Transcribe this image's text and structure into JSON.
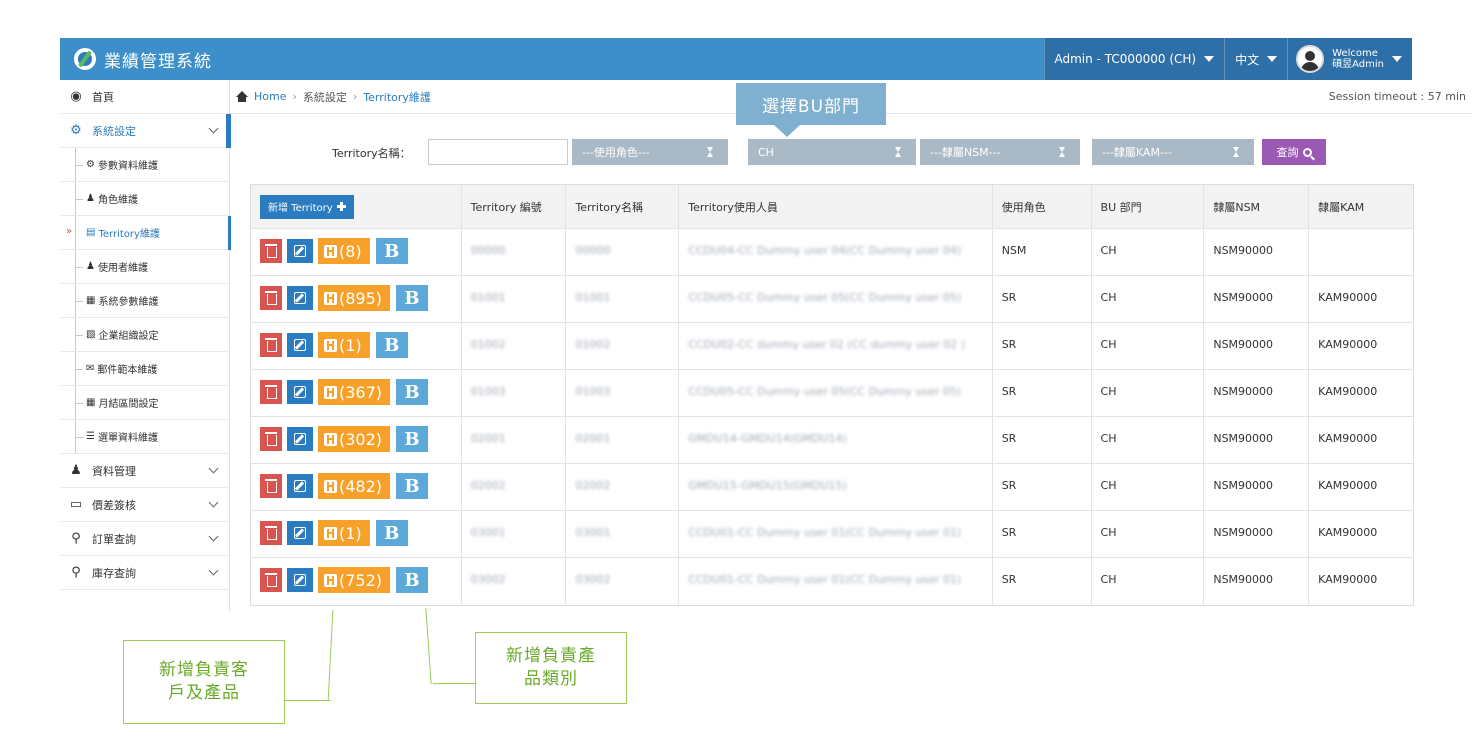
{
  "topbar": {
    "brand": "業績管理系統",
    "org_dropdown": "Admin - TC000000 (CH)",
    "language": "中文",
    "welcome_line1": "Welcome",
    "welcome_line2": "碩昱Admin"
  },
  "sidebar": {
    "items": [
      {
        "label": "首頁",
        "icon": "dashboard-icon"
      },
      {
        "label": "系統設定",
        "icon": "cogs-icon"
      }
    ],
    "sub_items": [
      {
        "label": "參數資料維護",
        "icon": "gear-icon"
      },
      {
        "label": "角色維護",
        "icon": "person-icon"
      },
      {
        "label": "Territory維護",
        "icon": "building-icon"
      },
      {
        "label": "使用者維護",
        "icon": "user-icon"
      },
      {
        "label": "系統參數維護",
        "icon": "table-icon"
      },
      {
        "label": "企業組織設定",
        "icon": "sitemap-icon"
      },
      {
        "label": "郵件範本維護",
        "icon": "envelope-icon"
      },
      {
        "label": "月結區間設定",
        "icon": "table-icon"
      },
      {
        "label": "選單資料維護",
        "icon": "list-icon"
      }
    ],
    "lower_items": [
      {
        "label": "資料管理",
        "icon": "users-icon"
      },
      {
        "label": "價差簽核",
        "icon": "monitor-icon"
      },
      {
        "label": "訂單查詢",
        "icon": "search-icon"
      },
      {
        "label": "庫存查詢",
        "icon": "search-icon"
      }
    ]
  },
  "breadcrumb": {
    "home": "Home",
    "sep": "›",
    "level1": "系統設定",
    "level2": "Territory維護",
    "session": "Session timeout : 57 min"
  },
  "callout_top": "選擇BU部門",
  "filters": {
    "name_label": "Territory名稱：",
    "name_value": "",
    "role_select": "---使用角色---",
    "bu_select": "CH",
    "nsm_select": "---隸屬NSM---",
    "kam_select": "---隸屬KAM---",
    "search_label": "查詢"
  },
  "table": {
    "add_button": "新增 Territory",
    "headers": [
      "Territory 編號",
      "Territory名稱",
      "Territory使用人員",
      "使用角色",
      "BU 部門",
      "隸屬NSM",
      "隸屬KAM"
    ],
    "b_label": "B",
    "rows": [
      {
        "count": "(8)",
        "code": "00000",
        "name": "00000",
        "user": "CCDU04-CC Dummy user 04(CC Dummy user 04)",
        "role": "NSM",
        "bu": "CH",
        "nsm": "NSM90000",
        "kam": ""
      },
      {
        "count": "(895)",
        "code": "01001",
        "name": "01001",
        "user": "CCDU05-CC Dummy user 05(CC Dummy user 05)",
        "role": "SR",
        "bu": "CH",
        "nsm": "NSM90000",
        "kam": "KAM90000"
      },
      {
        "count": "(1)",
        "code": "01002",
        "name": "01002",
        "user": "CCDU02-CC dummy user 02 (CC dummy user 02 )",
        "role": "SR",
        "bu": "CH",
        "nsm": "NSM90000",
        "kam": "KAM90000"
      },
      {
        "count": "(367)",
        "code": "01003",
        "name": "01003",
        "user": "CCDU05-CC Dummy user 05(CC Dummy user 05)",
        "role": "SR",
        "bu": "CH",
        "nsm": "NSM90000",
        "kam": "KAM90000"
      },
      {
        "count": "(302)",
        "code": "02001",
        "name": "02001",
        "user": "GMDU14-GMDU14(GMDU14)",
        "role": "SR",
        "bu": "CH",
        "nsm": "NSM90000",
        "kam": "KAM90000"
      },
      {
        "count": "(482)",
        "code": "02002",
        "name": "02002",
        "user": "GMDU15-GMDU15(GMDU15)",
        "role": "SR",
        "bu": "CH",
        "nsm": "NSM90000",
        "kam": "KAM90000"
      },
      {
        "count": "(1)",
        "code": "03001",
        "name": "03001",
        "user": "CCDU01-CC Dummy user 01(CC Dummy user 01)",
        "role": "SR",
        "bu": "CH",
        "nsm": "NSM90000",
        "kam": "KAM90000"
      },
      {
        "count": "(752)",
        "code": "03002",
        "name": "03002",
        "user": "CCDU01-CC Dummy user 01(CC Dummy user 01)",
        "role": "SR",
        "bu": "CH",
        "nsm": "NSM90000",
        "kam": "KAM90000"
      }
    ]
  },
  "notes": {
    "customer_product": [
      "新增負責客",
      "戶及產品"
    ],
    "product_category": [
      "新增負責產",
      "品類別"
    ]
  },
  "colors": {
    "topbar": "#3d8fc9",
    "primary": "#2a7bbf",
    "danger": "#d9534f",
    "warning": "#f7a12a",
    "info": "#5ca8d8",
    "search": "#9b59b6",
    "note": "#6aaa2a"
  }
}
